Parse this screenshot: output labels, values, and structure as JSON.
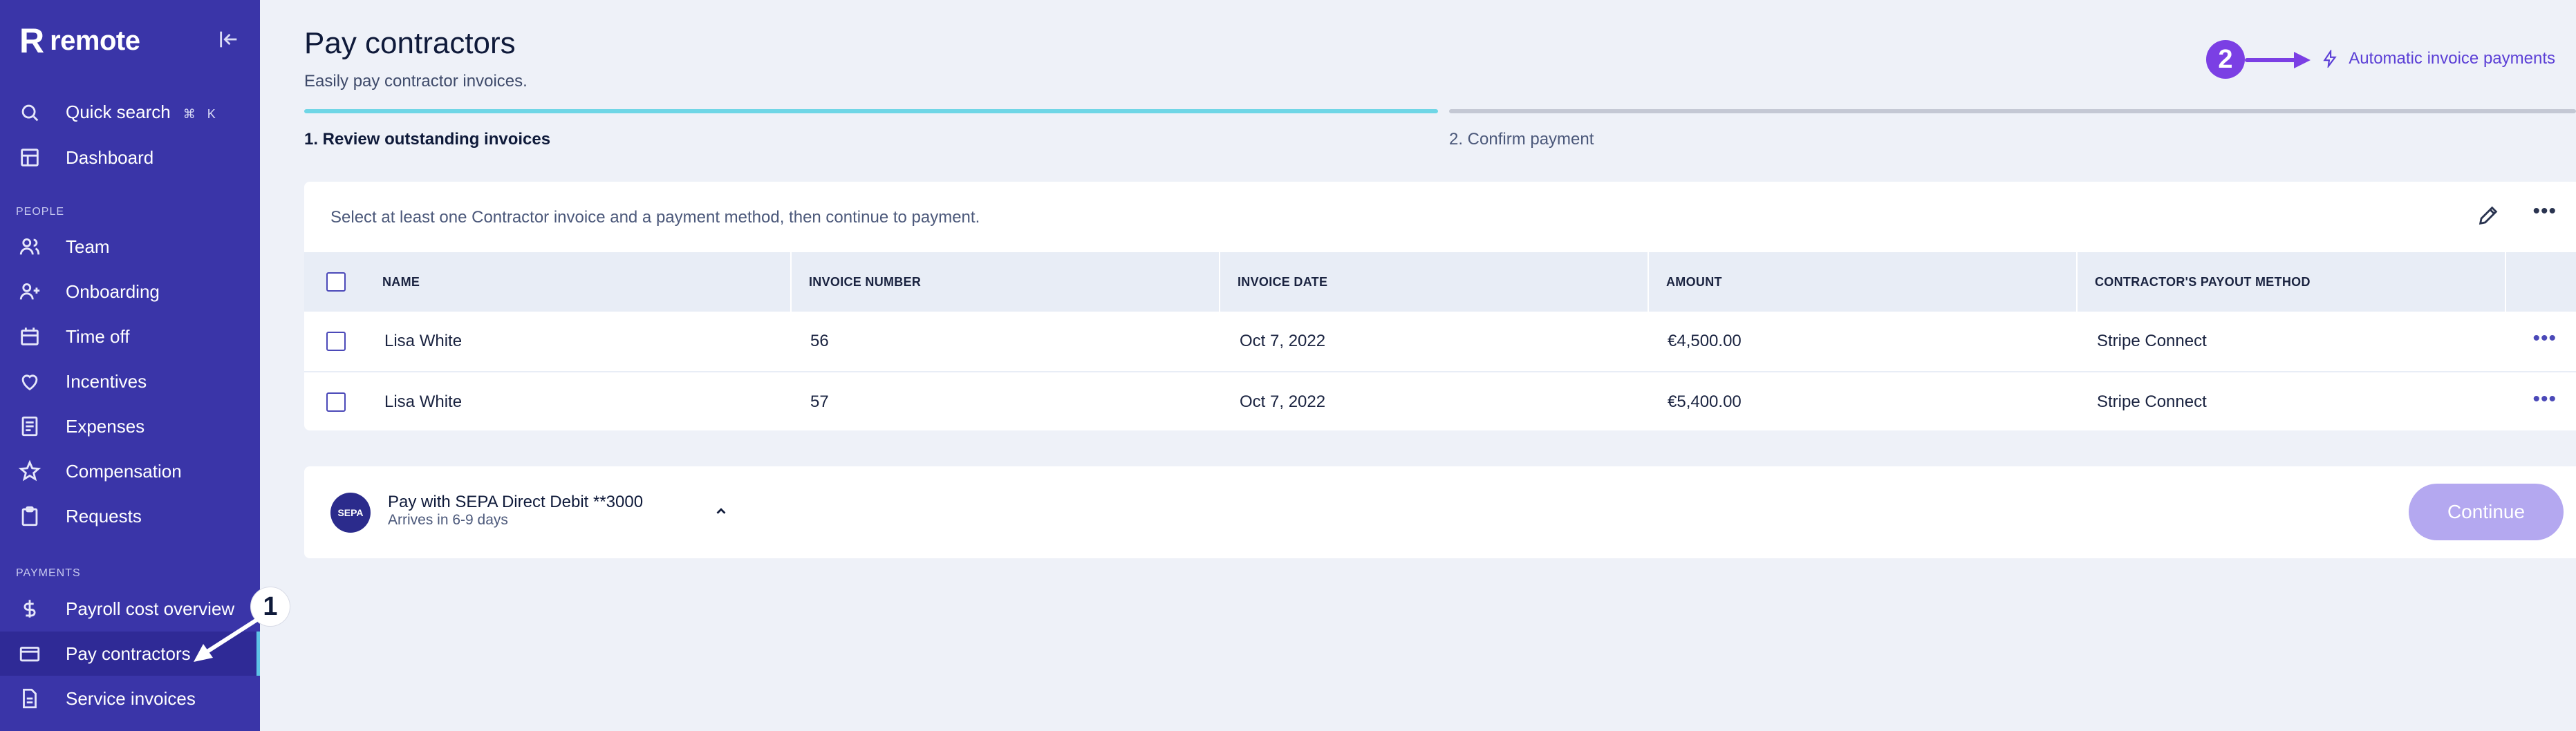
{
  "brand": {
    "logo_mark": "R",
    "name": "remote"
  },
  "sidebar": {
    "search": {
      "label": "Quick search",
      "key1": "⌘",
      "key2": "K"
    },
    "dashboard": "Dashboard",
    "people_section": "PEOPLE",
    "people_items": [
      "Team",
      "Onboarding",
      "Time off",
      "Incentives",
      "Expenses",
      "Compensation",
      "Requests"
    ],
    "payments_section": "PAYMENTS",
    "payments_items": [
      "Payroll cost overview",
      "Pay contractors",
      "Service invoices"
    ],
    "active_item": "Pay contractors"
  },
  "header": {
    "title": "Pay contractors",
    "subtitle": "Easily pay contractor invoices.",
    "auto_link": "Automatic invoice payments"
  },
  "steps": [
    {
      "label": "1. Review outstanding invoices",
      "active": true
    },
    {
      "label": "2. Confirm payment",
      "active": false
    }
  ],
  "panel": {
    "message": "Select at least one Contractor invoice and a payment method, then continue to payment.",
    "columns": [
      "NAME",
      "INVOICE NUMBER",
      "INVOICE DATE",
      "AMOUNT",
      "CONTRACTOR'S PAYOUT METHOD"
    ],
    "rows": [
      {
        "name": "Lisa White",
        "invoice_number": "56",
        "date": "Oct 7, 2022",
        "amount": "€4,500.00",
        "method": "Stripe Connect"
      },
      {
        "name": "Lisa White",
        "invoice_number": "57",
        "date": "Oct 7, 2022",
        "amount": "€5,400.00",
        "method": "Stripe Connect"
      }
    ]
  },
  "payment": {
    "logo_text": "SEPA",
    "title": "Pay with SEPA Direct Debit **3000",
    "subtitle": "Arrives in 6-9 days",
    "continue_label": "Continue"
  },
  "annotations": {
    "badge1": "1",
    "badge2": "2"
  },
  "colors": {
    "sidebar": "#3a35a8",
    "accent": "#5b3fd6",
    "badge": "#7b3fe4",
    "step_active": "#6fd6e6",
    "step_inactive": "#c4c8d4"
  }
}
